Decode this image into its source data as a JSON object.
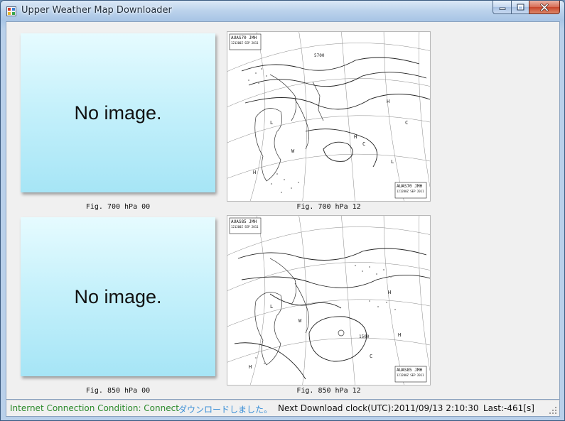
{
  "window": {
    "title": "Upper Weather Map Downloader"
  },
  "panels": {
    "p700_00": {
      "placeholder": "No image.",
      "caption": "Fig. 700 hPa 00"
    },
    "p700_12": {
      "caption": "Fig. 700 hPa 12",
      "stamp_id": "AUAS70 JMH",
      "stamp_time": "121200Z SEP 2011",
      "label_5700": "5700"
    },
    "p850_00": {
      "placeholder": "No image.",
      "caption": "Fig. 850 hPa 00"
    },
    "p850_12": {
      "caption": "Fig. 850 hPa 12",
      "stamp_id": "AUAS85 JMH",
      "stamp_time": "121200Z SEP 2011",
      "label_1500": "1500"
    }
  },
  "status": {
    "connection": "Internet Connection Condition: Connect",
    "message": "ダウンロードしました。",
    "next": "Next Download clock(UTC):2011/09/13 2:10:30",
    "last": "Last:-461[s]"
  },
  "colors": {
    "connection_text": "#2c8a2c",
    "message_text": "#3b8fd6",
    "placeholder_gradient_top": "#e6fbff",
    "placeholder_gradient_bottom": "#a6e5f6",
    "close_button": "#c7452b"
  },
  "icons": {
    "app": "app-window-icon",
    "minimize": "minimize-icon",
    "maximize": "maximize-icon",
    "close": "close-icon",
    "grip": "resize-grip-icon"
  }
}
